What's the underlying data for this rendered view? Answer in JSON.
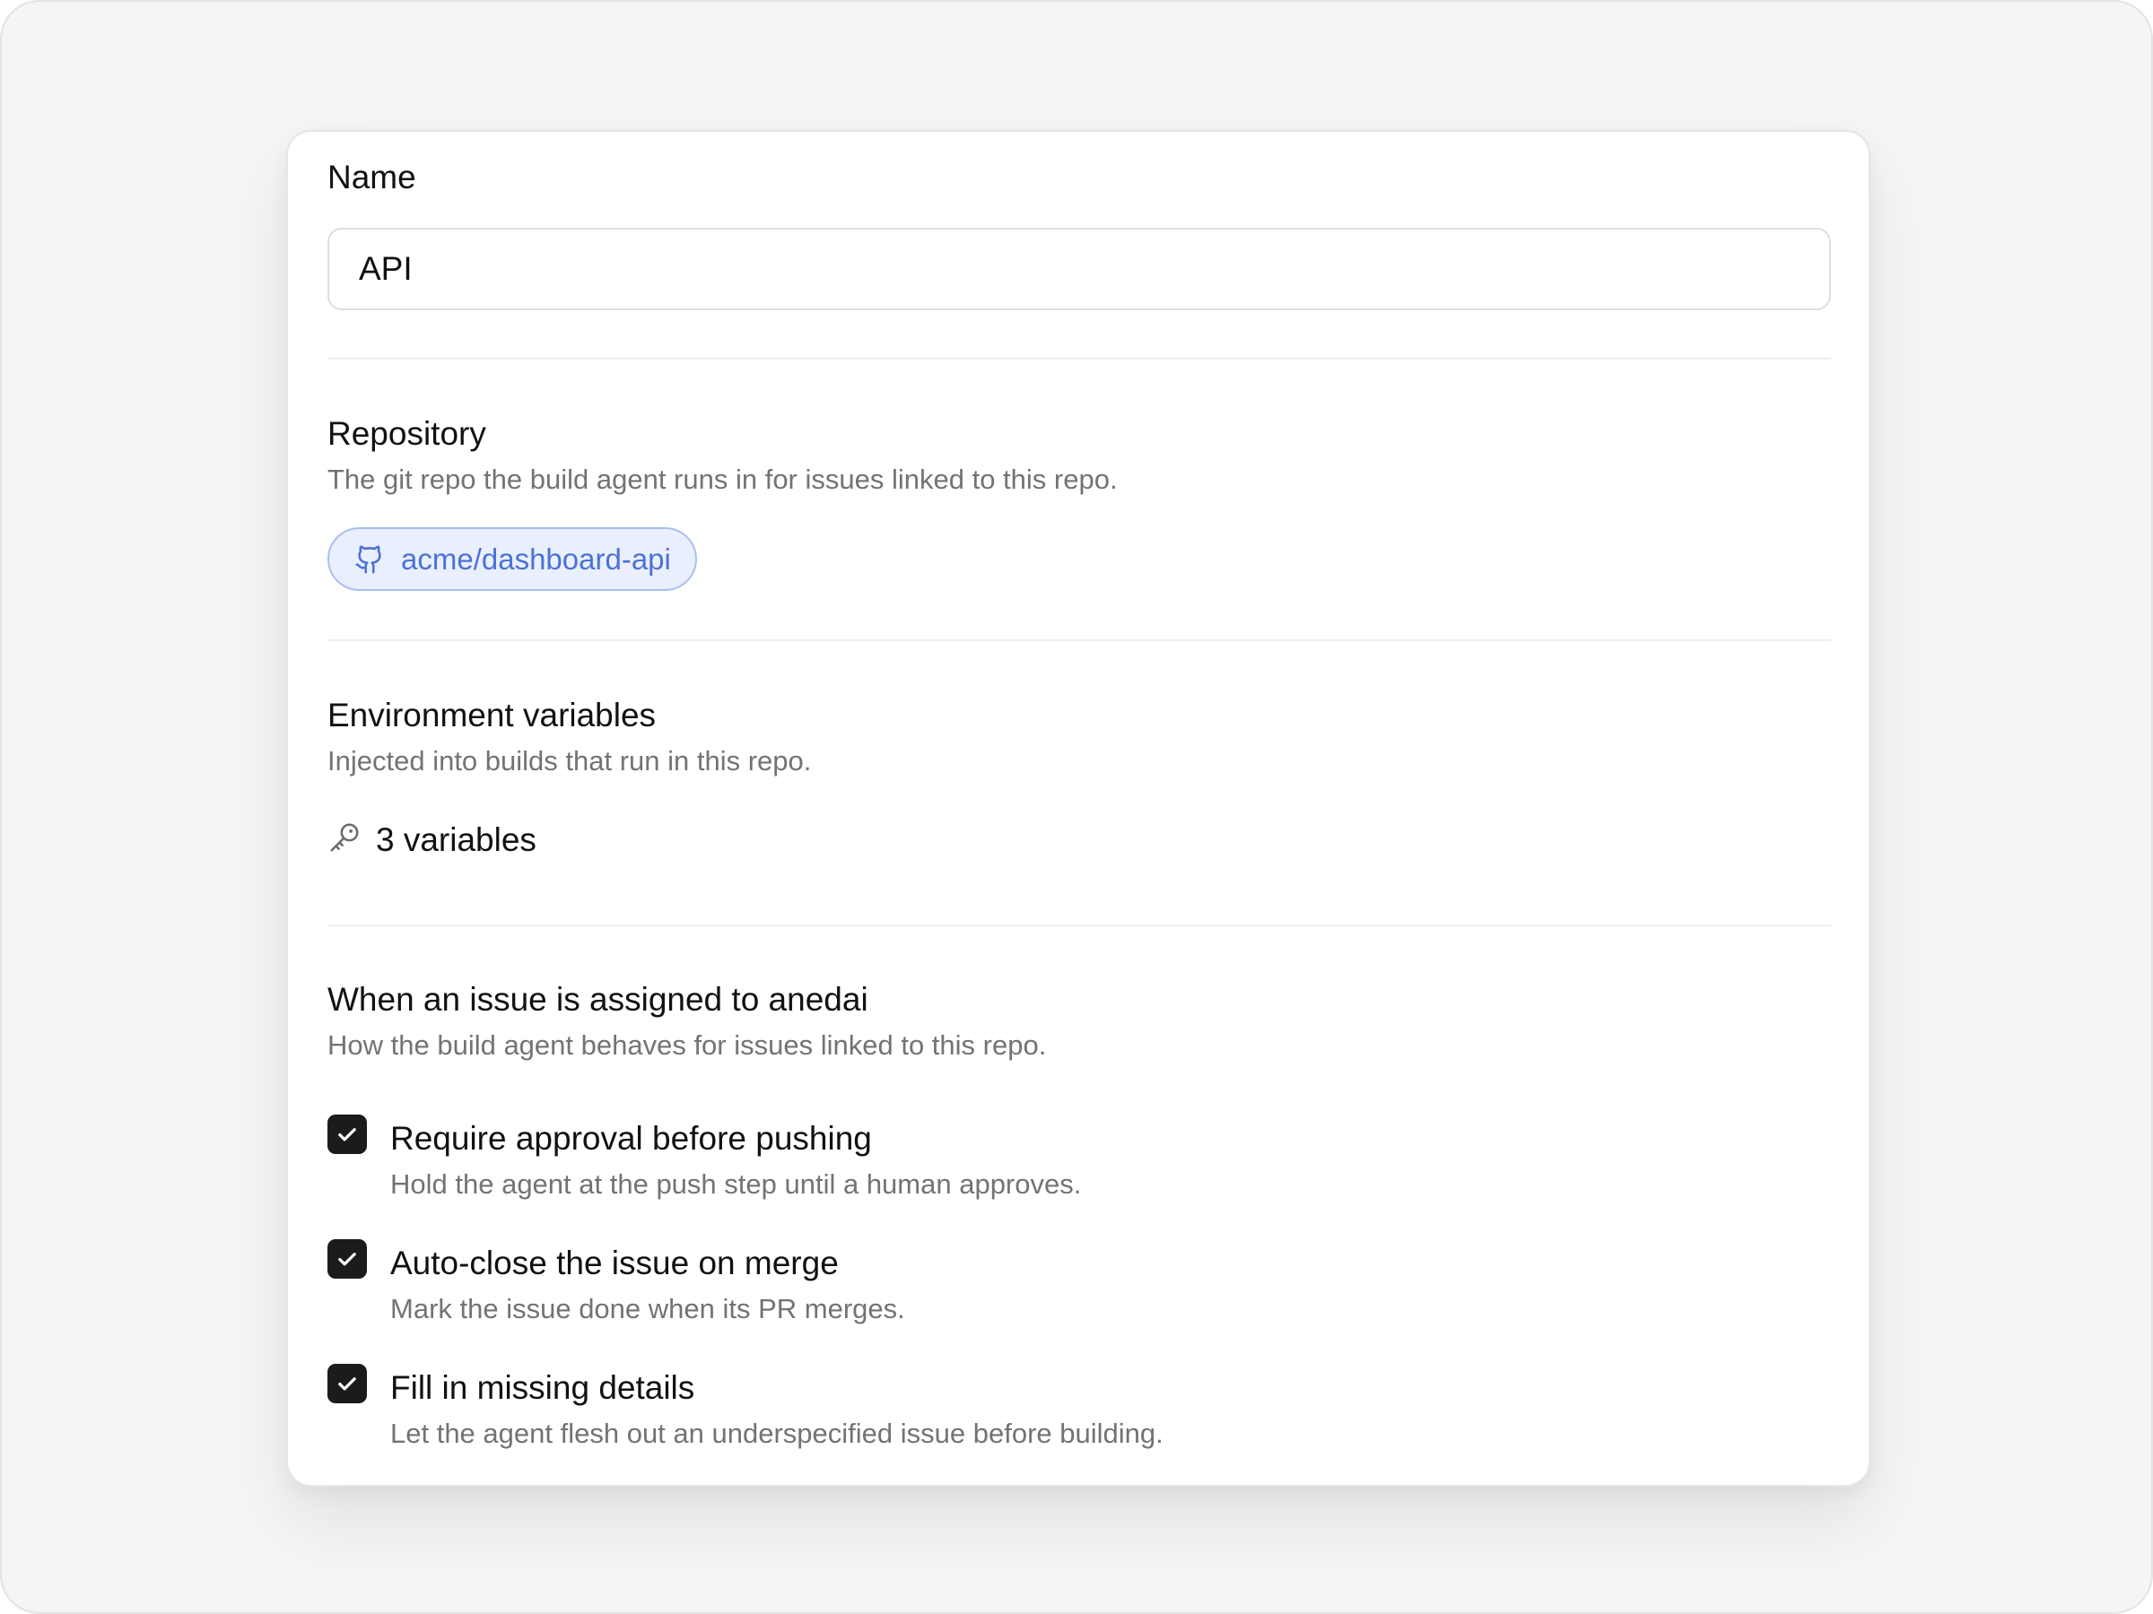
{
  "name_section": {
    "label": "Name",
    "value": "API"
  },
  "repository_section": {
    "title": "Repository",
    "description": "The git repo the build agent runs in for issues linked to this repo.",
    "repo_name": "acme/dashboard-api",
    "repo_icon": "github-icon",
    "accent_color": "#4b72d6"
  },
  "env_section": {
    "title": "Environment variables",
    "description": "Injected into builds that run in this repo.",
    "count_label": "3 variables",
    "icon": "key-icon"
  },
  "assignment_section": {
    "title": "When an issue is assigned to anedai",
    "description": "How the build agent behaves for issues linked to this repo.",
    "options": [
      {
        "title": "Require approval before pushing",
        "description": "Hold the agent at the push step until a human approves.",
        "checked": true
      },
      {
        "title": "Auto-close the issue on merge",
        "description": "Mark the issue done when its PR merges.",
        "checked": true
      },
      {
        "title": "Fill in missing details",
        "description": "Let the agent flesh out an underspecified issue before building.",
        "checked": true
      }
    ]
  }
}
